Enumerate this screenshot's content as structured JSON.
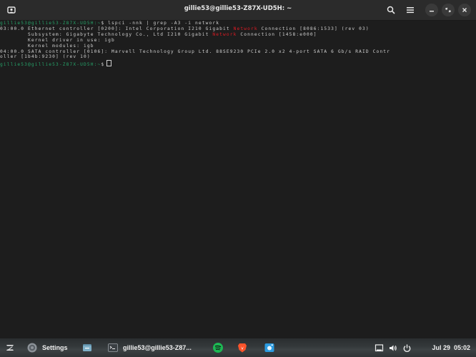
{
  "window": {
    "title": "gillie53@gillie53-Z87X-UD5H: ~"
  },
  "terminal": {
    "prompt1": "gillie53@gillie53-Z87X-UD5H:~",
    "cmd1": "$ lspci -nnk | grep -A3 -i network",
    "line1_pre": "03:00.0 Ethernet controller [0200]: Intel Corporation I210 Gigabit ",
    "line1_hl": "Network",
    "line1_post": " Connection [8086:1533] (rev 03)",
    "line2_pre": "        Subsystem: Gigabyte Technology Co., Ltd I210 Gigabit ",
    "line2_hl": "Network",
    "line2_post": " Connection [1458:e000]",
    "line3": "        Kernel driver in use: igb",
    "line4": "        Kernel modules: igb",
    "line5": "04:00.0 SATA controller [0106]: Marvell Technology Group Ltd. 88SE9230 PCIe 2.0 x2 4-port SATA 6 Gb/s RAID Contr",
    "line6": "oller [1b4b:9230] (rev 10)",
    "prompt2": "gillie53@gillie53-Z87X-UD5H:~",
    "cmd2": "$"
  },
  "taskbar": {
    "settings_label": "Settings",
    "terminal_label": "gillie53@gillie53-Z87...",
    "clock_date": "Jul 29",
    "clock_time": "05:02"
  },
  "icons": {
    "new_tab": "new-tab-icon",
    "search": "search-icon",
    "menu": "hamburger-menu-icon",
    "minimize": "minimize-icon",
    "restore": "restore-icon",
    "close": "close-icon",
    "app_launcher": "zorin-logo-icon",
    "settings": "gear-icon",
    "files": "file-manager-icon",
    "terminal": "terminal-icon",
    "spotify": "spotify-icon",
    "brave": "brave-browser-icon",
    "camera": "camera-icon",
    "battery": "battery-icon",
    "volume": "volume-icon",
    "power": "power-icon"
  },
  "colors": {
    "prompt": "#26a269",
    "highlight": "#e01b24",
    "background": "#1d1d1d"
  }
}
